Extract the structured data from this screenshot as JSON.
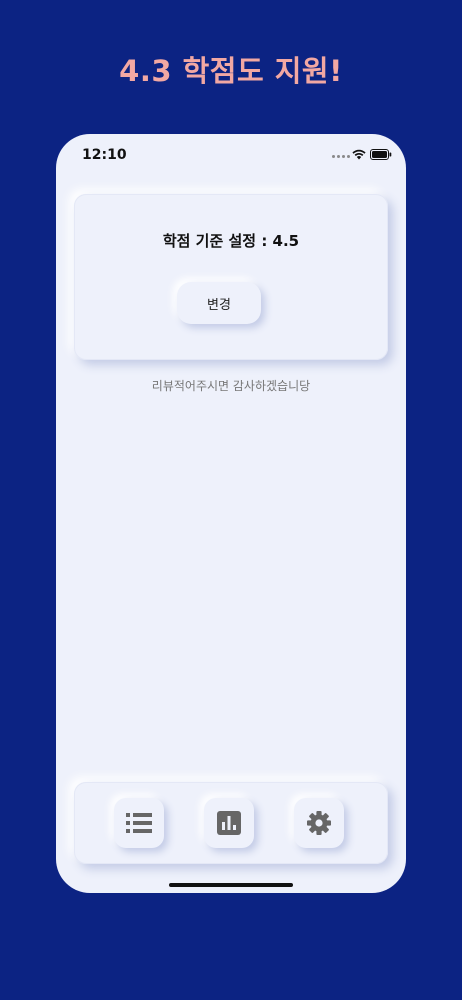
{
  "headline": "4.3 학점도 지원!",
  "status_bar": {
    "time": "12:10"
  },
  "settings_card": {
    "grade_label": "학점 기준 설정 : 4.5",
    "change_button": "변경"
  },
  "review_text": "리뷰적어주시면 감사하겠습니당",
  "tab_bar": {
    "tabs": [
      {
        "icon": "list-icon"
      },
      {
        "icon": "bar-chart-icon"
      },
      {
        "icon": "gear-icon"
      }
    ]
  },
  "colors": {
    "background": "#0c2383",
    "headline": "#f2a8a3",
    "surface": "#eef1fb",
    "icon": "#666666"
  }
}
